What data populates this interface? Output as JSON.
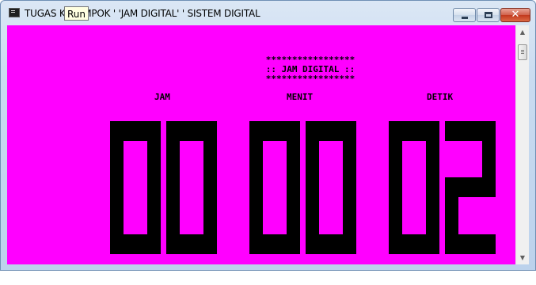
{
  "window": {
    "title": "TUGAS KELOMPOK ' 'JAM DIGITAL' ' SISTEM DIGITAL",
    "tooltip": "Run",
    "close_glyph": "✕"
  },
  "console": {
    "background_color": "#ff00ff",
    "foreground_color": "#000000",
    "banner": {
      "border_top": "*****************",
      "title": ":: JAM DIGITAL ::",
      "border_bottom": "*****************"
    },
    "labels": {
      "hours": "JAM",
      "minutes": "MENIT",
      "seconds": "DETIK"
    },
    "time": {
      "hours": "00",
      "minutes": "00",
      "seconds": "02",
      "digits": [
        "0",
        "0",
        "0",
        "0",
        "0",
        "2"
      ]
    }
  },
  "icons": {
    "app": "console-app-icon",
    "minimize": "minimize-icon",
    "maximize": "maximize-icon",
    "close": "close-icon",
    "scroll_up": "scroll-up-arrow-icon",
    "scroll_down": "scroll-down-arrow-icon"
  }
}
